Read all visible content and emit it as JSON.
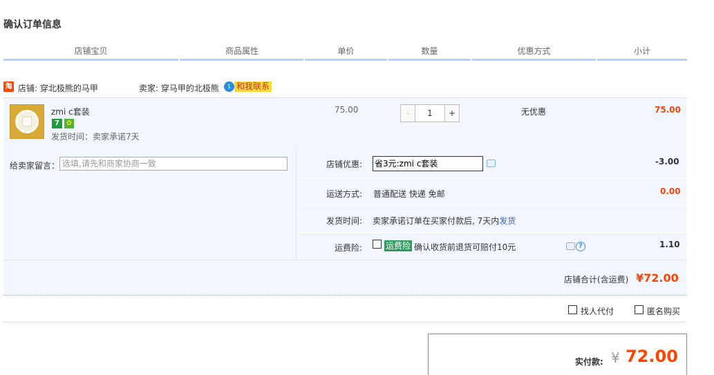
{
  "page": {
    "title": "确认订单信息"
  },
  "table_header": {
    "columns": [
      "店铺宝贝",
      "商品属性",
      "单价",
      "数量",
      "优惠方式",
      "小计"
    ]
  },
  "shop": {
    "icon_text": "淘",
    "shop_label": "店铺: 穿北极熊的马甲",
    "seller_label": "卖家: 穿马甲的北极熊",
    "wangwang_icon": "1",
    "contact_label": "和我联系"
  },
  "item": {
    "name": "zmi c套装",
    "badge_7": "7",
    "badge_medal": "✿",
    "ship_time": "发货时间：卖家承诺7天",
    "unit_price": "75.00",
    "quantity": "1",
    "minus": "-",
    "plus": "+",
    "discount": "无优惠",
    "subtotal": "75.00"
  },
  "options": {
    "message_label": "给卖家留言：",
    "message_placeholder": "选填,请先和商家协商一致",
    "shop_discount_label": "店铺优惠:",
    "shop_discount_selected": "省3元:zmi c套装",
    "shop_discount_value": "-3.00",
    "shipping_label": "运送方式:",
    "shipping_value": "普通配送 快递 免邮",
    "shipping_fee": "0.00",
    "delivery_label": "发货时间:",
    "delivery_text": "卖家承诺订单在买家付款后, 7天内",
    "delivery_link": "发货",
    "insurance_label": "运费险:",
    "insurance_tag": "运费险",
    "insurance_desc": "确认收货前退货可赔付10元",
    "insurance_help": "?",
    "insurance_value": "1.10"
  },
  "totals": {
    "shop_total_label": "店铺合计(含运费)",
    "shop_total_value": "¥72.00"
  },
  "extras": {
    "proxy_label": "找人代付",
    "anon_label": "匿名购买"
  },
  "payment": {
    "label": "实付款:",
    "currency": "¥",
    "amount": "72.00"
  },
  "colors": {
    "accent": "#ff4400",
    "header_line": "#b2d1ff",
    "row_bg": "#f2f7ff",
    "link": "#3366cc"
  }
}
